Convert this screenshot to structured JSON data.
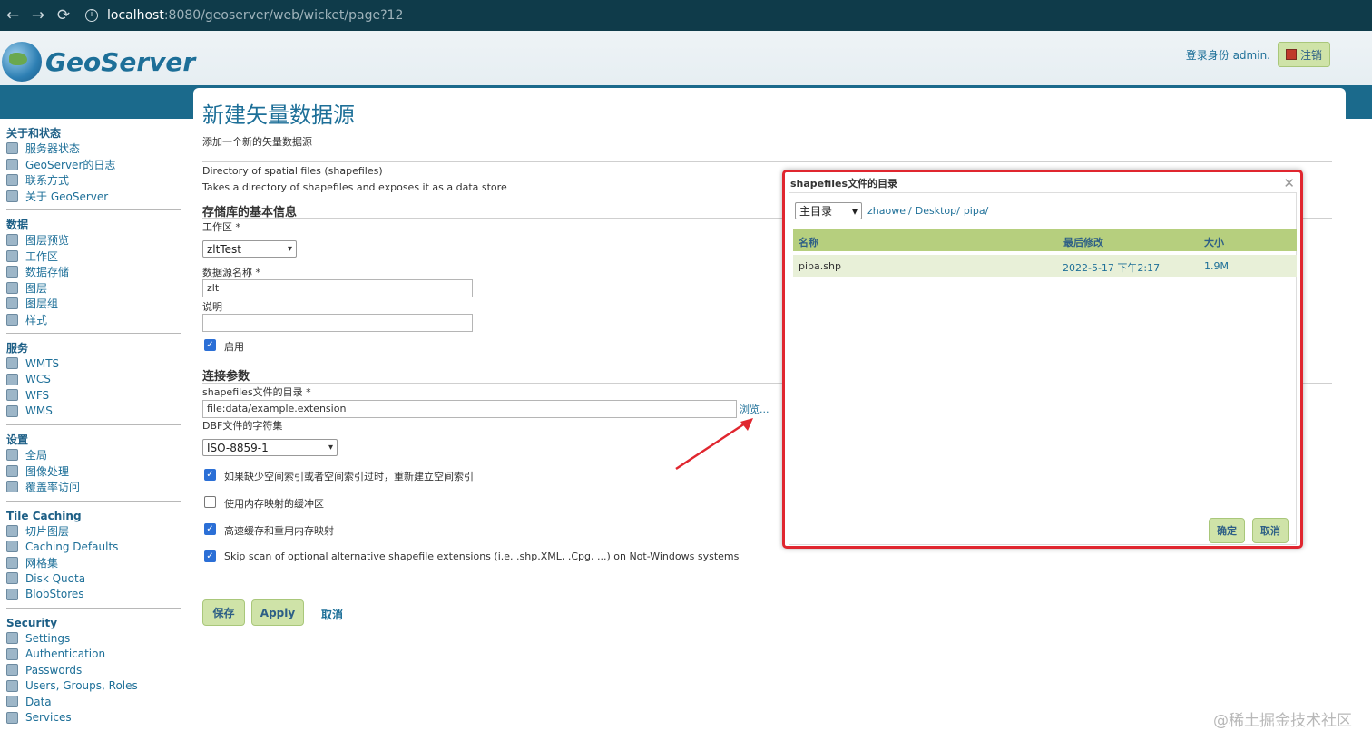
{
  "browser": {
    "back": "←",
    "forward": "→",
    "reload": "⟳",
    "url_host": "localhost",
    "url_path": ":8080/geoserver/web/wicket/page?12"
  },
  "header": {
    "logo_text": "GeoServer",
    "login_text": "登录身份 admin.",
    "logout_label": "注销"
  },
  "sidebar": {
    "sections": [
      {
        "title": "关于和状态",
        "items": [
          "服务器状态",
          "GeoServer的日志",
          "联系方式",
          "关于 GeoServer"
        ]
      },
      {
        "title": "数据",
        "items": [
          "图层预览",
          "工作区",
          "数据存储",
          "图层",
          "图层组",
          "样式"
        ]
      },
      {
        "title": "服务",
        "items": [
          "WMTS",
          "WCS",
          "WFS",
          "WMS"
        ]
      },
      {
        "title": "设置",
        "items": [
          "全局",
          "图像处理",
          "覆盖率访问"
        ]
      },
      {
        "title": "Tile Caching",
        "items": [
          "切片图层",
          "Caching Defaults",
          "网格集",
          "Disk Quota",
          "BlobStores"
        ]
      },
      {
        "title": "Security",
        "items": [
          "Settings",
          "Authentication",
          "Passwords",
          "Users, Groups, Roles",
          "Data",
          "Services"
        ]
      }
    ]
  },
  "main": {
    "title": "新建矢量数据源",
    "description": "添加一个新的矢量数据源",
    "store_type": "Directory of spatial files (shapefiles)",
    "store_desc": "Takes a directory of shapefiles and exposes it as a data store",
    "basic_info_title": "存储库的基本信息",
    "workspace_label": "工作区 *",
    "workspace_value": "zltTest",
    "name_label": "数据源名称 *",
    "name_value": "zlt",
    "desc_label": "说明",
    "desc_value": "",
    "enabled_label": "启用",
    "conn_title": "连接参数",
    "dir_label": "shapefiles文件的目录 *",
    "dir_value": "file:data/example.extension",
    "browse_label": "浏览...",
    "charset_label": "DBF文件的字符集",
    "charset_value": "ISO-8859-1",
    "options": [
      {
        "label": "如果缺少空间索引或者空间索引过时，重新建立空间索引",
        "checked": true
      },
      {
        "label": "使用内存映射的缓冲区",
        "checked": false
      },
      {
        "label": "高速缓存和重用内存映射",
        "checked": true
      },
      {
        "label": "Skip scan of optional alternative shapefile extensions (i.e. .shp.XML, .Cpg, ...) on Not-Windows systems",
        "checked": true
      }
    ],
    "save_label": "保存",
    "apply_label": "Apply",
    "cancel_label": "取消"
  },
  "dialog": {
    "title": "shapefiles文件的目录",
    "close": "✕",
    "root_select": "主目录",
    "path": [
      "zhaowei/",
      "Desktop/",
      "pipa/"
    ],
    "columns": [
      "名称",
      "最后修改",
      "大小"
    ],
    "rows": [
      {
        "name": "pipa.shp",
        "modified": "2022-5-17 下午2:17",
        "size": "1.9M"
      }
    ],
    "ok_label": "确定",
    "cancel_label": "取消"
  },
  "watermark": "@稀土掘金技术社区",
  "colors": {
    "accent": "#1d6f98",
    "header_band": "#1b6a8c",
    "button_green": "#cfe3a8",
    "highlight_border": "#e0262f"
  }
}
